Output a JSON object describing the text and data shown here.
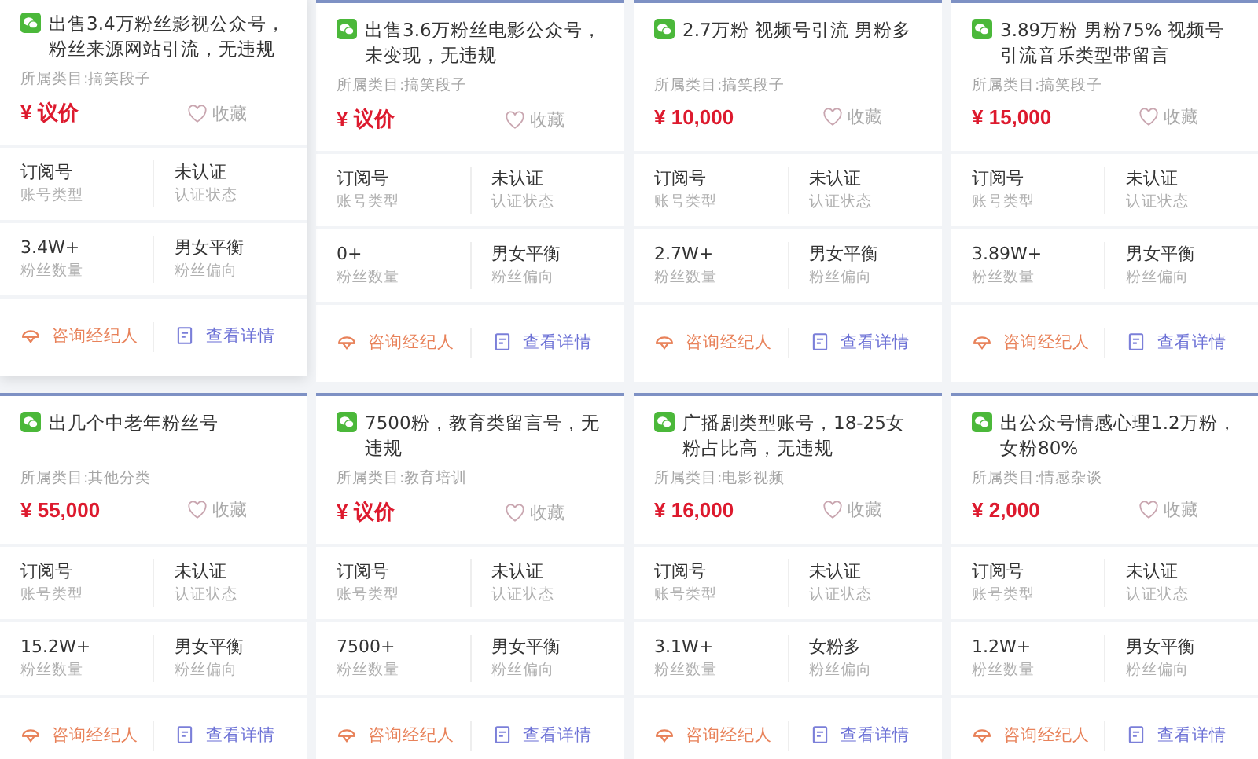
{
  "cards": [
    {
      "highlighted": true,
      "title": "出售3.4万粉丝影视公众号，粉丝来源网站引流，无违规",
      "category": "所属类目:搞笑段子",
      "price": "¥ 议价",
      "favorite": {
        "label": "收藏",
        "checked": false
      },
      "stats": [
        {
          "value": "订阅号",
          "label": "账号类型"
        },
        {
          "value": "未认证",
          "label": "认证状态"
        },
        {
          "value": "3.4W+",
          "label": "粉丝数量"
        },
        {
          "value": "男女平衡",
          "label": "粉丝偏向"
        }
      ],
      "actions": [
        {
          "kind": "consult",
          "label": "咨询经纪人"
        },
        {
          "kind": "details",
          "label": "查看详情"
        }
      ]
    },
    {
      "highlighted": false,
      "title": "出售3.6万粉丝电影公众号，未变现，无违规",
      "category": "所属类目:搞笑段子",
      "price": "¥ 议价",
      "favorite": {
        "label": "收藏",
        "checked": false
      },
      "stats": [
        {
          "value": "订阅号",
          "label": "账号类型"
        },
        {
          "value": "未认证",
          "label": "认证状态"
        },
        {
          "value": "0+",
          "label": "粉丝数量"
        },
        {
          "value": "男女平衡",
          "label": "粉丝偏向"
        }
      ],
      "actions": [
        {
          "kind": "consult",
          "label": "咨询经纪人"
        },
        {
          "kind": "details",
          "label": "查看详情"
        }
      ]
    },
    {
      "highlighted": false,
      "title": "2.7万粉 视频号引流 男粉多",
      "category": "所属类目:搞笑段子",
      "price": "¥ 10,000",
      "favorite": {
        "label": "收藏",
        "checked": false
      },
      "stats": [
        {
          "value": "订阅号",
          "label": "账号类型"
        },
        {
          "value": "未认证",
          "label": "认证状态"
        },
        {
          "value": "2.7W+",
          "label": "粉丝数量"
        },
        {
          "value": "男女平衡",
          "label": "粉丝偏向"
        }
      ],
      "actions": [
        {
          "kind": "consult",
          "label": "咨询经纪人"
        },
        {
          "kind": "details",
          "label": "查看详情"
        }
      ]
    },
    {
      "highlighted": false,
      "title": "3.89万粉 男粉75% 视频号引流音乐类型带留言",
      "category": "所属类目:搞笑段子",
      "price": "¥ 15,000",
      "favorite": {
        "label": "收藏",
        "checked": false
      },
      "stats": [
        {
          "value": "订阅号",
          "label": "账号类型"
        },
        {
          "value": "未认证",
          "label": "认证状态"
        },
        {
          "value": "3.89W+",
          "label": "粉丝数量"
        },
        {
          "value": "男女平衡",
          "label": "粉丝偏向"
        }
      ],
      "actions": [
        {
          "kind": "consult",
          "label": "咨询经纪人"
        },
        {
          "kind": "details",
          "label": "查看详情"
        }
      ]
    },
    {
      "highlighted": false,
      "title": "出几个中老年粉丝号",
      "category": "所属类目:其他分类",
      "price": "¥ 55,000",
      "favorite": {
        "label": "收藏",
        "checked": false
      },
      "stats": [
        {
          "value": "订阅号",
          "label": "账号类型"
        },
        {
          "value": "未认证",
          "label": "认证状态"
        },
        {
          "value": "15.2W+",
          "label": "粉丝数量"
        },
        {
          "value": "男女平衡",
          "label": "粉丝偏向"
        }
      ],
      "actions": [
        {
          "kind": "consult",
          "label": "咨询经纪人"
        },
        {
          "kind": "details",
          "label": "查看详情"
        }
      ]
    },
    {
      "highlighted": false,
      "title": "7500粉，教育类留言号，无违规",
      "category": "所属类目:教育培训",
      "price": "¥ 议价",
      "favorite": {
        "label": "收藏",
        "checked": false
      },
      "stats": [
        {
          "value": "订阅号",
          "label": "账号类型"
        },
        {
          "value": "未认证",
          "label": "认证状态"
        },
        {
          "value": "7500+",
          "label": "粉丝数量"
        },
        {
          "value": "男女平衡",
          "label": "粉丝偏向"
        }
      ],
      "actions": [
        {
          "kind": "consult",
          "label": "咨询经纪人"
        },
        {
          "kind": "details",
          "label": "查看详情"
        }
      ]
    },
    {
      "highlighted": false,
      "title": "广播剧类型账号，18-25女粉占比高，无违规",
      "category": "所属类目:电影视频",
      "price": "¥ 16,000",
      "favorite": {
        "label": "收藏",
        "checked": false
      },
      "stats": [
        {
          "value": "订阅号",
          "label": "账号类型"
        },
        {
          "value": "未认证",
          "label": "认证状态"
        },
        {
          "value": "3.1W+",
          "label": "粉丝数量"
        },
        {
          "value": "女粉多",
          "label": "粉丝偏向"
        }
      ],
      "actions": [
        {
          "kind": "consult",
          "label": "咨询经纪人"
        },
        {
          "kind": "details",
          "label": "查看详情"
        }
      ]
    },
    {
      "highlighted": false,
      "title": "出公众号情感心理1.2万粉，女粉80%",
      "category": "所属类目:情感杂谈",
      "price": "¥ 2,000",
      "favorite": {
        "label": "收藏",
        "checked": false
      },
      "stats": [
        {
          "value": "订阅号",
          "label": "账号类型"
        },
        {
          "value": "未认证",
          "label": "认证状态"
        },
        {
          "value": "1.2W+",
          "label": "粉丝数量"
        },
        {
          "value": "男女平衡",
          "label": "粉丝偏向"
        }
      ],
      "actions": [
        {
          "kind": "consult",
          "label": "咨询经纪人"
        },
        {
          "kind": "details",
          "label": "查看详情"
        }
      ]
    }
  ]
}
